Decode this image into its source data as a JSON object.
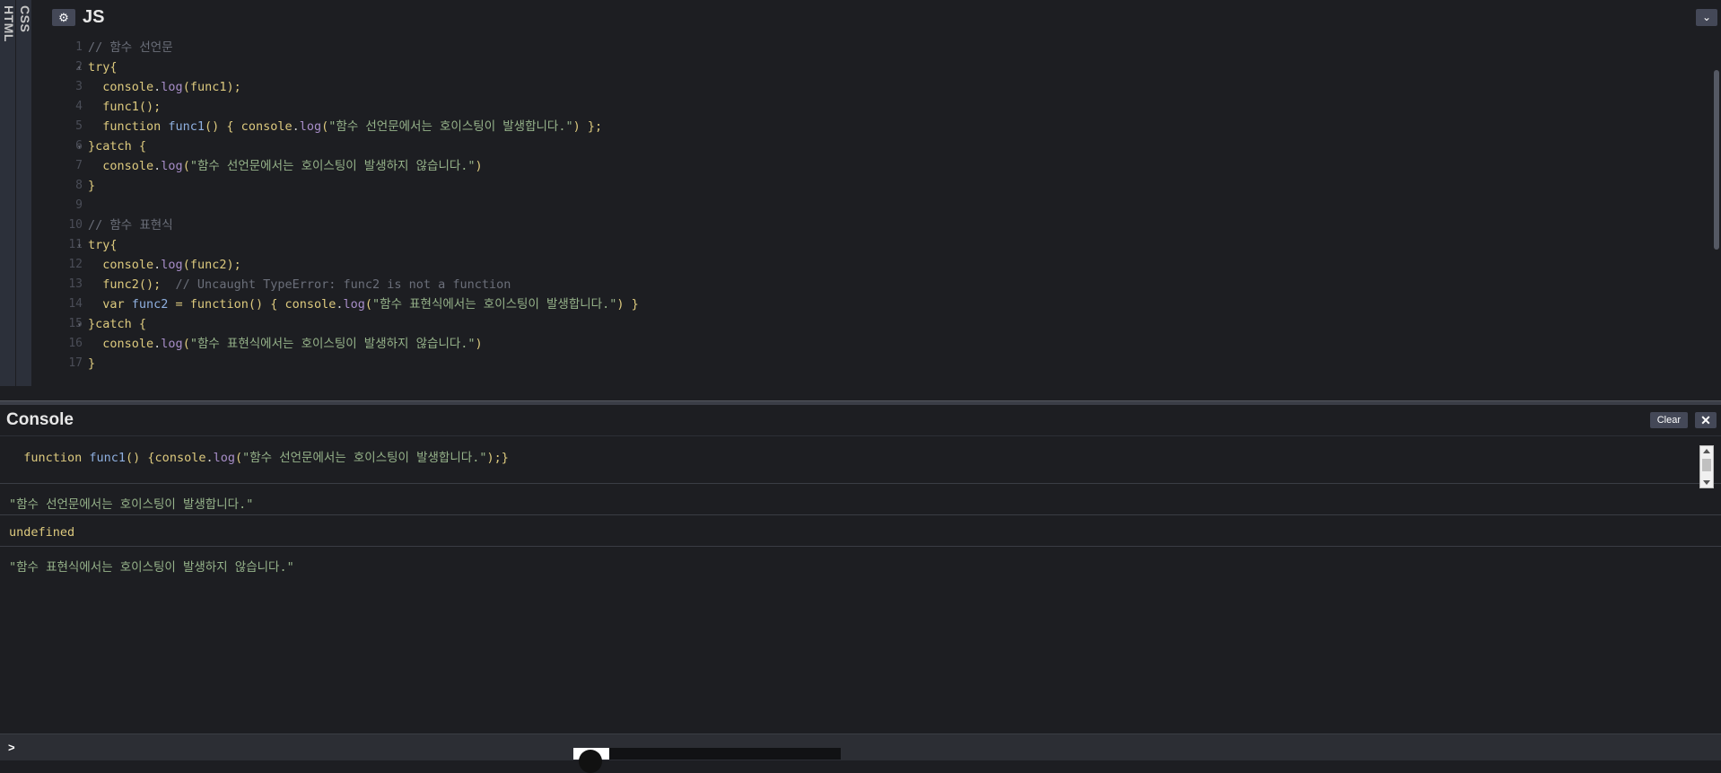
{
  "editor": {
    "side_tabs": [
      "HTML",
      "CSS"
    ],
    "panel_title": "JS",
    "settings_icon": "gear-icon",
    "collapse_icon": "chevron-down-icon",
    "line_numbers": [
      "1",
      "2",
      "3",
      "4",
      "5",
      "6",
      "7",
      "8",
      "9",
      "10",
      "11",
      "12",
      "13",
      "14",
      "15",
      "16",
      "17"
    ],
    "fold_lines": [
      2,
      6,
      11,
      15
    ],
    "lines": [
      [
        {
          "t": "// 함수 선언문",
          "c": "c-gray"
        }
      ],
      [
        {
          "t": "try{",
          "c": "c-kw"
        }
      ],
      [
        {
          "t": "  console",
          "c": "c-kw"
        },
        {
          "t": ".",
          "c": "c-punc"
        },
        {
          "t": "log",
          "c": "c-fn"
        },
        {
          "t": "(func1);",
          "c": "c-kw"
        }
      ],
      [
        {
          "t": "  func1();",
          "c": "c-kw"
        }
      ],
      [
        {
          "t": "  function ",
          "c": "c-kw"
        },
        {
          "t": "func1",
          "c": "c-def"
        },
        {
          "t": "() { console",
          "c": "c-kw"
        },
        {
          "t": ".",
          "c": "c-punc"
        },
        {
          "t": "log",
          "c": "c-fn"
        },
        {
          "t": "(",
          "c": "c-kw"
        },
        {
          "t": "\"함수 선언문에서는 호이스팅이 발생합니다.\"",
          "c": "c-str"
        },
        {
          "t": ") };",
          "c": "c-kw"
        }
      ],
      [
        {
          "t": "}catch {",
          "c": "c-kw"
        }
      ],
      [
        {
          "t": "  console",
          "c": "c-kw"
        },
        {
          "t": ".",
          "c": "c-punc"
        },
        {
          "t": "log",
          "c": "c-fn"
        },
        {
          "t": "(",
          "c": "c-kw"
        },
        {
          "t": "\"함수 선언문에서는 호이스팅이 발생하지 않습니다.\"",
          "c": "c-str"
        },
        {
          "t": ")",
          "c": "c-kw"
        }
      ],
      [
        {
          "t": "}",
          "c": "c-kw"
        }
      ],
      [
        {
          "t": "",
          "c": "c-plain"
        }
      ],
      [
        {
          "t": "// 함수 표현식",
          "c": "c-gray"
        }
      ],
      [
        {
          "t": "try{",
          "c": "c-kw"
        }
      ],
      [
        {
          "t": "  console",
          "c": "c-kw"
        },
        {
          "t": ".",
          "c": "c-punc"
        },
        {
          "t": "log",
          "c": "c-fn"
        },
        {
          "t": "(func2);",
          "c": "c-kw"
        }
      ],
      [
        {
          "t": "  func2();  ",
          "c": "c-kw"
        },
        {
          "t": "// Uncaught TypeError: func2 is not a function",
          "c": "c-gray"
        }
      ],
      [
        {
          "t": "  var ",
          "c": "c-kw"
        },
        {
          "t": "func2",
          "c": "c-def"
        },
        {
          "t": " = function() { console",
          "c": "c-kw"
        },
        {
          "t": ".",
          "c": "c-punc"
        },
        {
          "t": "log",
          "c": "c-fn"
        },
        {
          "t": "(",
          "c": "c-kw"
        },
        {
          "t": "\"함수 표현식에서는 호이스팅이 발생합니다.\"",
          "c": "c-str"
        },
        {
          "t": ") }",
          "c": "c-kw"
        }
      ],
      [
        {
          "t": "}catch {",
          "c": "c-kw"
        }
      ],
      [
        {
          "t": "  console",
          "c": "c-kw"
        },
        {
          "t": ".",
          "c": "c-punc"
        },
        {
          "t": "log",
          "c": "c-fn"
        },
        {
          "t": "(",
          "c": "c-kw"
        },
        {
          "t": "\"함수 표현식에서는 호이스팅이 발생하지 않습니다.\"",
          "c": "c-str"
        },
        {
          "t": ")",
          "c": "c-kw"
        }
      ],
      [
        {
          "t": "}",
          "c": "c-kw"
        }
      ]
    ]
  },
  "console": {
    "title": "Console",
    "clear_label": "Clear",
    "close_icon": "close-icon",
    "prompt": ">",
    "entries": [
      [
        {
          "t": "  function ",
          "c": "c-kw"
        },
        {
          "t": "func1",
          "c": "c-def"
        },
        {
          "t": "() {console",
          "c": "c-kw"
        },
        {
          "t": ".",
          "c": "c-punc"
        },
        {
          "t": "log",
          "c": "c-fn"
        },
        {
          "t": "(",
          "c": "c-kw"
        },
        {
          "t": "\"함수 선언문에서는 호이스팅이 발생합니다.\"",
          "c": "c-str"
        },
        {
          "t": ");}",
          "c": "c-kw"
        }
      ],
      [
        {
          "t": "\"함수 선언문에서는 호이스팅이 발생합니다.\"",
          "c": "c-str"
        }
      ],
      [
        {
          "t": "undefined",
          "c": "c-kw"
        }
      ],
      [
        {
          "t": "\"함수 표현식에서는 호이스팅이 발생하지 않습니다.\"",
          "c": "c-str"
        }
      ]
    ]
  }
}
